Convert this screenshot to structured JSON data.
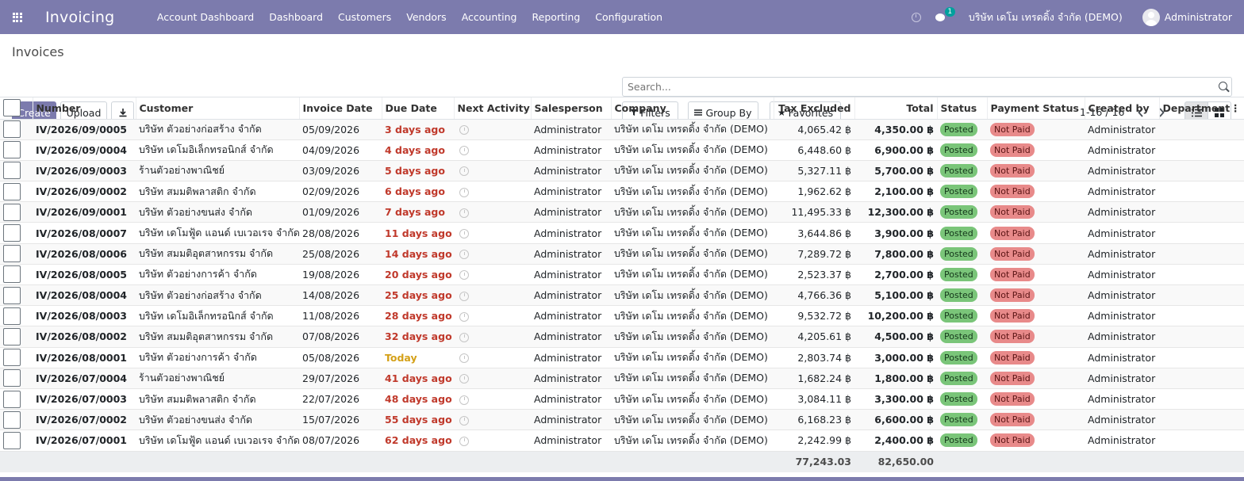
{
  "navbar": {
    "app_title": "Invoicing",
    "menu": [
      "Account Dashboard",
      "Dashboard",
      "Customers",
      "Vendors",
      "Accounting",
      "Reporting",
      "Configuration"
    ],
    "chat_count": "1",
    "company": "บริษัท เดโม เทรดดิ้ง จำกัด (DEMO)",
    "user": "Administrator"
  },
  "control": {
    "breadcrumb": "Invoices",
    "create_label": "Create",
    "upload_label": "Upload",
    "search_placeholder": "Search...",
    "filters_label": "Filters",
    "group_by_label": "Group By",
    "favorites_label": "Favorites",
    "pager_text": "1-16 / 16"
  },
  "table": {
    "columns": [
      "Number",
      "Customer",
      "Invoice Date",
      "Due Date",
      "Next Activity",
      "Salesperson",
      "Company",
      "Tax Excluded",
      "Total",
      "Status",
      "Payment Status",
      "Created by",
      "Department"
    ],
    "rows": [
      {
        "number": "IV/2026/09/0005",
        "customer": "บริษัท ตัวอย่างก่อสร้าง จำกัด",
        "invoice_date": "05/09/2026",
        "due": "3 days ago",
        "due_state": "late",
        "salesperson": "Administrator",
        "company": "บริษัท เดโม เทรดดิ้ง จำกัด (DEMO)",
        "tax_excluded": "4,065.42 ฿",
        "total": "4,350.00 ฿",
        "status": "Posted",
        "payment_status": "Not Paid",
        "created_by": "Administrator",
        "department": ""
      },
      {
        "number": "IV/2026/09/0004",
        "customer": "บริษัท เดโมอิเล็กทรอนิกส์ จำกัด",
        "invoice_date": "04/09/2026",
        "due": "4 days ago",
        "due_state": "late",
        "salesperson": "Administrator",
        "company": "บริษัท เดโม เทรดดิ้ง จำกัด (DEMO)",
        "tax_excluded": "6,448.60 ฿",
        "total": "6,900.00 ฿",
        "status": "Posted",
        "payment_status": "Not Paid",
        "created_by": "Administrator",
        "department": ""
      },
      {
        "number": "IV/2026/09/0003",
        "customer": "ร้านตัวอย่างพาณิชย์",
        "invoice_date": "03/09/2026",
        "due": "5 days ago",
        "due_state": "late",
        "salesperson": "Administrator",
        "company": "บริษัท เดโม เทรดดิ้ง จำกัด (DEMO)",
        "tax_excluded": "5,327.11 ฿",
        "total": "5,700.00 ฿",
        "status": "Posted",
        "payment_status": "Not Paid",
        "created_by": "Administrator",
        "department": ""
      },
      {
        "number": "IV/2026/09/0002",
        "customer": "บริษัท สมมติพลาสติก จำกัด",
        "invoice_date": "02/09/2026",
        "due": "6 days ago",
        "due_state": "late",
        "salesperson": "Administrator",
        "company": "บริษัท เดโม เทรดดิ้ง จำกัด (DEMO)",
        "tax_excluded": "1,962.62 ฿",
        "total": "2,100.00 ฿",
        "status": "Posted",
        "payment_status": "Not Paid",
        "created_by": "Administrator",
        "department": ""
      },
      {
        "number": "IV/2026/09/0001",
        "customer": "บริษัท ตัวอย่างขนส่ง จำกัด",
        "invoice_date": "01/09/2026",
        "due": "7 days ago",
        "due_state": "late",
        "salesperson": "Administrator",
        "company": "บริษัท เดโม เทรดดิ้ง จำกัด (DEMO)",
        "tax_excluded": "11,495.33 ฿",
        "total": "12,300.00 ฿",
        "status": "Posted",
        "payment_status": "Not Paid",
        "created_by": "Administrator",
        "department": ""
      },
      {
        "number": "IV/2026/08/0007",
        "customer": "บริษัท เดโมฟู้ด แอนด์ เบเวอเรจ จำกัด",
        "invoice_date": "28/08/2026",
        "due": "11 days ago",
        "due_state": "late",
        "salesperson": "Administrator",
        "company": "บริษัท เดโม เทรดดิ้ง จำกัด (DEMO)",
        "tax_excluded": "3,644.86 ฿",
        "total": "3,900.00 ฿",
        "status": "Posted",
        "payment_status": "Not Paid",
        "created_by": "Administrator",
        "department": ""
      },
      {
        "number": "IV/2026/08/0006",
        "customer": "บริษัท สมมติอุตสาหกรรม จำกัด",
        "invoice_date": "25/08/2026",
        "due": "14 days ago",
        "due_state": "late",
        "salesperson": "Administrator",
        "company": "บริษัท เดโม เทรดดิ้ง จำกัด (DEMO)",
        "tax_excluded": "7,289.72 ฿",
        "total": "7,800.00 ฿",
        "status": "Posted",
        "payment_status": "Not Paid",
        "created_by": "Administrator",
        "department": ""
      },
      {
        "number": "IV/2026/08/0005",
        "customer": "บริษัท ตัวอย่างการค้า จำกัด",
        "invoice_date": "19/08/2026",
        "due": "20 days ago",
        "due_state": "late",
        "salesperson": "Administrator",
        "company": "บริษัท เดโม เทรดดิ้ง จำกัด (DEMO)",
        "tax_excluded": "2,523.37 ฿",
        "total": "2,700.00 ฿",
        "status": "Posted",
        "payment_status": "Not Paid",
        "created_by": "Administrator",
        "department": ""
      },
      {
        "number": "IV/2026/08/0004",
        "customer": "บริษัท ตัวอย่างก่อสร้าง จำกัด",
        "invoice_date": "14/08/2026",
        "due": "25 days ago",
        "due_state": "late",
        "salesperson": "Administrator",
        "company": "บริษัท เดโม เทรดดิ้ง จำกัด (DEMO)",
        "tax_excluded": "4,766.36 ฿",
        "total": "5,100.00 ฿",
        "status": "Posted",
        "payment_status": "Not Paid",
        "created_by": "Administrator",
        "department": ""
      },
      {
        "number": "IV/2026/08/0003",
        "customer": "บริษัท เดโมอิเล็กทรอนิกส์ จำกัด",
        "invoice_date": "11/08/2026",
        "due": "28 days ago",
        "due_state": "late",
        "salesperson": "Administrator",
        "company": "บริษัท เดโม เทรดดิ้ง จำกัด (DEMO)",
        "tax_excluded": "9,532.72 ฿",
        "total": "10,200.00 ฿",
        "status": "Posted",
        "payment_status": "Not Paid",
        "created_by": "Administrator",
        "department": ""
      },
      {
        "number": "IV/2026/08/0002",
        "customer": "บริษัท สมมติอุตสาหกรรม จำกัด",
        "invoice_date": "07/08/2026",
        "due": "32 days ago",
        "due_state": "late",
        "salesperson": "Administrator",
        "company": "บริษัท เดโม เทรดดิ้ง จำกัด (DEMO)",
        "tax_excluded": "4,205.61 ฿",
        "total": "4,500.00 ฿",
        "status": "Posted",
        "payment_status": "Not Paid",
        "created_by": "Administrator",
        "department": ""
      },
      {
        "number": "IV/2026/08/0001",
        "customer": "บริษัท ตัวอย่างการค้า จำกัด",
        "invoice_date": "05/08/2026",
        "due": "Today",
        "due_state": "today",
        "salesperson": "Administrator",
        "company": "บริษัท เดโม เทรดดิ้ง จำกัด (DEMO)",
        "tax_excluded": "2,803.74 ฿",
        "total": "3,000.00 ฿",
        "status": "Posted",
        "payment_status": "Not Paid",
        "created_by": "Administrator",
        "department": ""
      },
      {
        "number": "IV/2026/07/0004",
        "customer": "ร้านตัวอย่างพาณิชย์",
        "invoice_date": "29/07/2026",
        "due": "41 days ago",
        "due_state": "late",
        "salesperson": "Administrator",
        "company": "บริษัท เดโม เทรดดิ้ง จำกัด (DEMO)",
        "tax_excluded": "1,682.24 ฿",
        "total": "1,800.00 ฿",
        "status": "Posted",
        "payment_status": "Not Paid",
        "created_by": "Administrator",
        "department": ""
      },
      {
        "number": "IV/2026/07/0003",
        "customer": "บริษัท สมมติพลาสติก จำกัด",
        "invoice_date": "22/07/2026",
        "due": "48 days ago",
        "due_state": "late",
        "salesperson": "Administrator",
        "company": "บริษัท เดโม เทรดดิ้ง จำกัด (DEMO)",
        "tax_excluded": "3,084.11 ฿",
        "total": "3,300.00 ฿",
        "status": "Posted",
        "payment_status": "Not Paid",
        "created_by": "Administrator",
        "department": ""
      },
      {
        "number": "IV/2026/07/0002",
        "customer": "บริษัท ตัวอย่างขนส่ง จำกัด",
        "invoice_date": "15/07/2026",
        "due": "55 days ago",
        "due_state": "late",
        "salesperson": "Administrator",
        "company": "บริษัท เดโม เทรดดิ้ง จำกัด (DEMO)",
        "tax_excluded": "6,168.23 ฿",
        "total": "6,600.00 ฿",
        "status": "Posted",
        "payment_status": "Not Paid",
        "created_by": "Administrator",
        "department": ""
      },
      {
        "number": "IV/2026/07/0001",
        "customer": "บริษัท เดโมฟู้ด แอนด์ เบเวอเรจ จำกัด",
        "invoice_date": "08/07/2026",
        "due": "62 days ago",
        "due_state": "late",
        "salesperson": "Administrator",
        "company": "บริษัท เดโม เทรดดิ้ง จำกัด (DEMO)",
        "tax_excluded": "2,242.99 ฿",
        "total": "2,400.00 ฿",
        "status": "Posted",
        "payment_status": "Not Paid",
        "created_by": "Administrator",
        "department": ""
      }
    ],
    "totals": {
      "tax_excluded": "77,243.03",
      "total": "82,650.00"
    }
  },
  "colors": {
    "brand": "#7c7bad",
    "late": "#c0392b",
    "today": "#d4a017",
    "posted": "#7ac579",
    "not_paid": "#e88a8a"
  }
}
